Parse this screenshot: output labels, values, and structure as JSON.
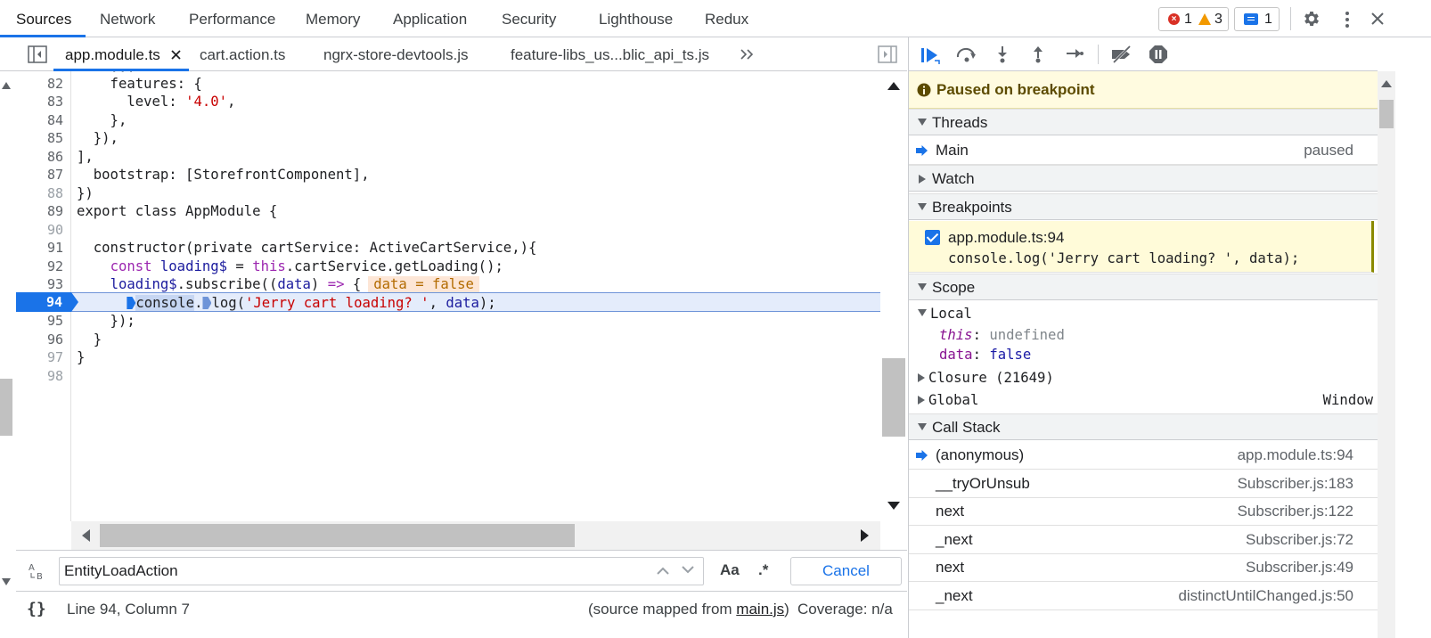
{
  "top_tabs": [
    "Sources",
    "Network",
    "Performance",
    "Memory",
    "Application",
    "Security",
    "Lighthouse",
    "Redux"
  ],
  "badges": {
    "errors": "1",
    "warnings": "3",
    "messages": "1"
  },
  "file_tabs": {
    "active": "app.module.ts",
    "others": [
      "cart.action.ts",
      "ngrx-store-devtools.js",
      "feature-libs_us...blic_api_ts.js"
    ]
  },
  "editor": {
    "line_numbers": [
      "82",
      "83",
      "84",
      "85",
      "86",
      "87",
      "88",
      "89",
      "90",
      "91",
      "92",
      "93",
      "94",
      "95",
      "96",
      "97",
      "98"
    ],
    "l82": "    features: {",
    "l83a": "      level: ",
    "l83b": "'4.0'",
    "l83c": ",",
    "l84": "    },",
    "l85": "  }),",
    "l86": "],",
    "l87": "  bootstrap: [StorefrontComponent],",
    "l88": "})",
    "l89": "export class AppModule {",
    "l91": "  constructor(private cartService: ActiveCartService,){",
    "l92a": "const ",
    "l92b": "loading$",
    "l92c": " = ",
    "l92d": "this",
    "l92e": ".cartService.getLoading();",
    "l93a": "loading$",
    "l93b": ".subscribe((",
    "l93c": "data",
    "l93d": ") ",
    "l93e": "=>",
    "l93f": " {",
    "l93_inline": "data = false",
    "l94a": "console",
    "l94b": ".",
    "l94c": "log(",
    "l94d": "'Jerry cart loading? '",
    "l94e": ", ",
    "l94f": "data",
    "l94g": ");",
    "l95": "    });",
    "l96": "  }",
    "l97": "}"
  },
  "search": {
    "value": "EntityLoadAction",
    "case_label": "Aa",
    "regex_label": ".*",
    "cancel": "Cancel"
  },
  "status": {
    "format_icon": "{}",
    "position": "Line 94, Column 7",
    "mapped_prefix": "(source mapped from ",
    "mapped_file": "main.js",
    "mapped_suffix": ")",
    "coverage": "Coverage: n/a"
  },
  "debugger": {
    "paused": "Paused on breakpoint",
    "threads_title": "Threads",
    "thread_name": "Main",
    "thread_state": "paused",
    "watch_title": "Watch",
    "breakpoints_title": "Breakpoints",
    "bp_location": "app.module.ts:94",
    "bp_code": "console.log('Jerry cart loading? ', data);",
    "scope_title": "Scope",
    "local_title": "Local",
    "this_name": "this",
    "this_value": "undefined",
    "data_name": "data",
    "data_value": "false",
    "closure": "Closure (21649)",
    "global": "Global",
    "global_value": "Window",
    "callstack_title": "Call Stack",
    "frames": [
      {
        "fn": "(anonymous)",
        "loc": "app.module.ts:94"
      },
      {
        "fn": "__tryOrUnsub",
        "loc": "Subscriber.js:183"
      },
      {
        "fn": "next",
        "loc": "Subscriber.js:122"
      },
      {
        "fn": "_next",
        "loc": "Subscriber.js:72"
      },
      {
        "fn": "next",
        "loc": "Subscriber.js:49"
      },
      {
        "fn": "_next",
        "loc": "distinctUntilChanged.js:50"
      }
    ]
  },
  "colors": {
    "accent": "#1a73e8",
    "paused_bg": "#fffbe0",
    "string": "#c80000",
    "keyword": "#9c27b0"
  }
}
